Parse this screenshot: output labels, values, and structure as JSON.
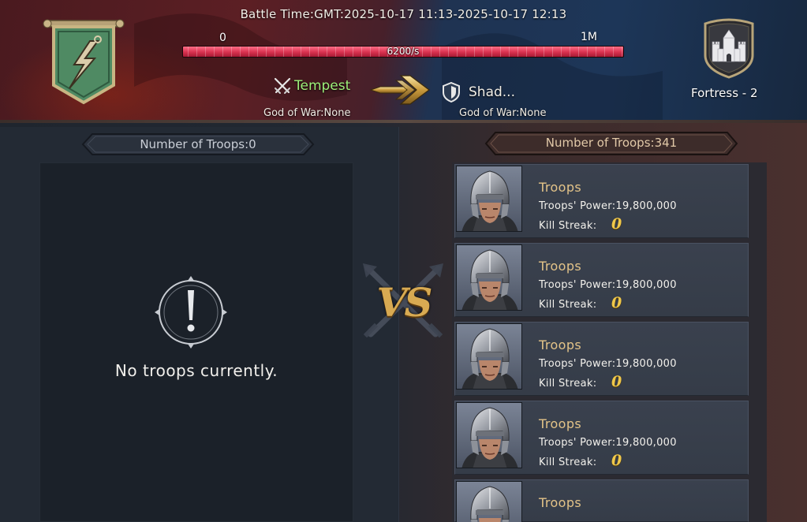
{
  "header": {
    "battle_time": "Battle Time:GMT:2025-10-17 11:13-2025-10-17 12:13",
    "progress": {
      "min_label": "0",
      "max_label": "1M",
      "rate_label": "6200/s",
      "fill_fraction": 1.0
    },
    "attacker": {
      "name": "Tempest",
      "god_of_war": "God of War:None",
      "banner_icon": "lightning-banner-icon",
      "team_icon": "crossed-swords-icon"
    },
    "defender": {
      "name": "Shad...",
      "god_of_war": "God of War:None",
      "team_icon": "shield-icon"
    },
    "target": {
      "label": "Fortress - 2",
      "icon": "fortress-icon"
    }
  },
  "left_panel": {
    "troop_count": "Number of Troops:0",
    "empty_message": "No troops currently.",
    "empty_icon": "alert-icon"
  },
  "vs_label": "VS",
  "right_panel": {
    "troop_count": "Number of Troops:341",
    "troops": [
      {
        "title": "Troops",
        "power": "Troops' Power:19,800,000",
        "kill_label": "Kill Streak:",
        "kill_value": "0"
      },
      {
        "title": "Troops",
        "power": "Troops' Power:19,800,000",
        "kill_label": "Kill Streak:",
        "kill_value": "0"
      },
      {
        "title": "Troops",
        "power": "Troops' Power:19,800,000",
        "kill_label": "Kill Streak:",
        "kill_value": "0"
      },
      {
        "title": "Troops",
        "power": "Troops' Power:19,800,000",
        "kill_label": "Kill Streak:",
        "kill_value": "0"
      },
      {
        "title": "Troops"
      }
    ]
  },
  "colors": {
    "attacker_name": "#9ef07a",
    "troop_title": "#e3c388",
    "kill_value": "#f0c84a",
    "bar_fill": "#d8314f",
    "banner_green": "#4f8a63"
  }
}
